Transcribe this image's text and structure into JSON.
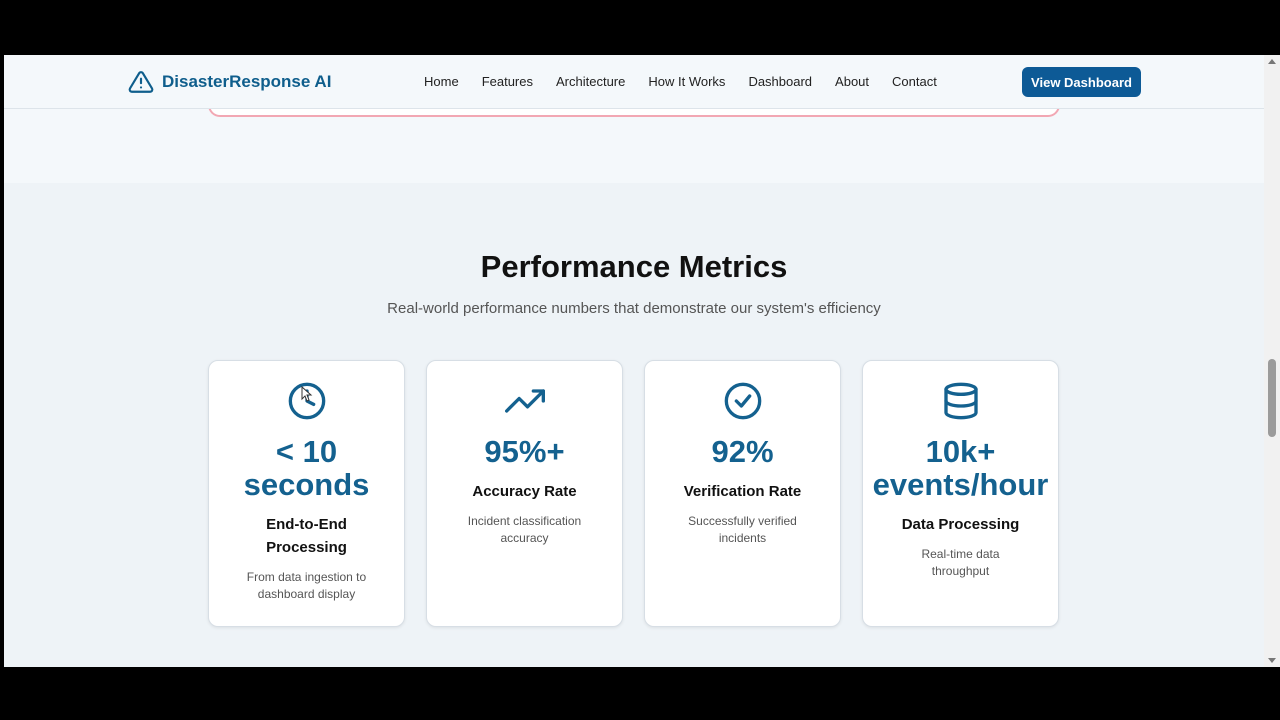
{
  "brand": {
    "name": "DisasterResponse AI",
    "icon": "alert-triangle-icon"
  },
  "nav": {
    "links": [
      "Home",
      "Features",
      "Architecture",
      "How It Works",
      "Dashboard",
      "About",
      "Contact"
    ],
    "cta_label": "View Dashboard"
  },
  "metrics": {
    "title": "Performance Metrics",
    "subtitle": "Real-world performance numbers that demonstrate our system's efficiency",
    "cards": [
      {
        "icon": "clock-icon",
        "value": "< 10 seconds",
        "label": "End-to-End Processing",
        "desc": "From data ingestion to dashboard display"
      },
      {
        "icon": "trending-up-icon",
        "value": "95%+",
        "label": "Accuracy Rate",
        "desc": "Incident classification accuracy"
      },
      {
        "icon": "check-circle-icon",
        "value": "92%",
        "label": "Verification Rate",
        "desc": "Successfully verified incidents"
      },
      {
        "icon": "database-icon",
        "value": "10k+ events/hour",
        "label": "Data Processing",
        "desc": "Real-time data throughput"
      }
    ]
  },
  "colors": {
    "brand": "#0f5e8c",
    "accent": "#0d5a96",
    "metric_value": "#14618f",
    "alert_border": "#f2a7b3"
  }
}
